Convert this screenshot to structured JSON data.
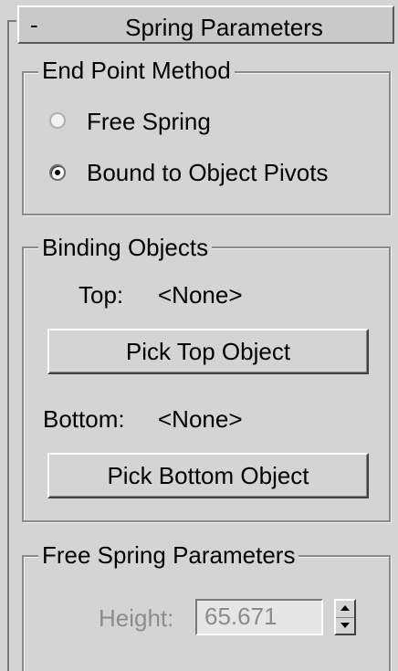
{
  "rollout": {
    "toggle": "-",
    "title": "Spring Parameters"
  },
  "end_point_method": {
    "label": "End Point Method",
    "options": [
      {
        "label": "Free Spring",
        "selected": false
      },
      {
        "label": "Bound to Object Pivots",
        "selected": true
      }
    ]
  },
  "binding_objects": {
    "label": "Binding Objects",
    "top_label": "Top:",
    "top_value": "<None>",
    "pick_top_button": "Pick Top Object",
    "bottom_label": "Bottom:",
    "bottom_value": "<None>",
    "pick_bottom_button": "Pick Bottom Object"
  },
  "free_spring_parameters": {
    "label": "Free Spring Parameters",
    "height_label": "Height:",
    "height_value": "65.671",
    "enabled": false
  }
}
